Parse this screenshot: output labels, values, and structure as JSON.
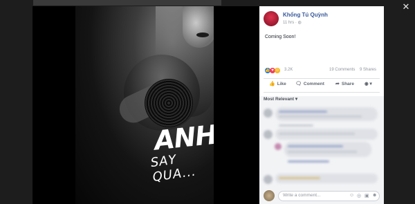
{
  "viewer": {
    "close_label": "✕"
  },
  "poster": {
    "title_line1": "ANH",
    "title_line2": "SAY QUA..."
  },
  "post": {
    "author": "Khổng Tú Quỳnh",
    "time": "11 hrs",
    "privacy_icon": "globe-icon",
    "text": "Coming Soon!",
    "reactions": {
      "count": "3.2K",
      "types": [
        "like",
        "love",
        "haha"
      ]
    },
    "comments_count": "19 Comments",
    "shares_count": "9 Shares"
  },
  "actions": {
    "like": "Like",
    "comment": "Comment",
    "share": "Share"
  },
  "comments": {
    "sort_label": "Most Relevant",
    "write_placeholder": "Write a comment..."
  },
  "colors": {
    "link": "#385898",
    "like_blue": "#1877f2",
    "love_red": "#f33e58",
    "haha_yellow": "#f7b928"
  }
}
